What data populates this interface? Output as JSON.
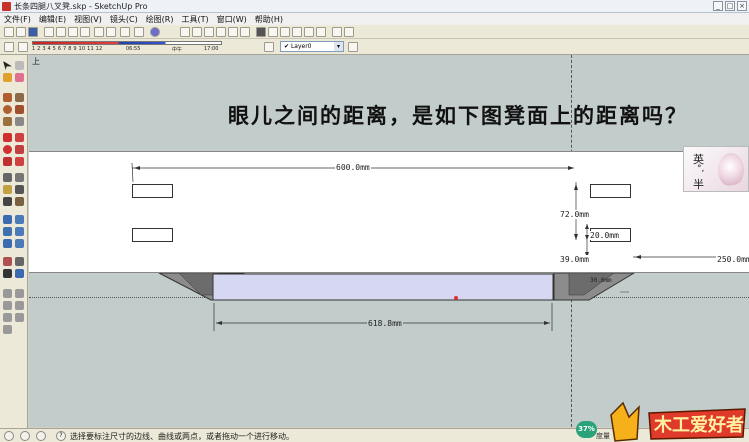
{
  "window": {
    "title": "长条四腿八叉凳.skp - SketchUp Pro",
    "min_glyph": "_",
    "max_glyph": "□",
    "close_glyph": "×"
  },
  "menu": {
    "items": [
      "文件(F)",
      "编辑(E)",
      "视图(V)",
      "镜头(C)",
      "绘图(R)",
      "工具(T)",
      "窗口(W)",
      "帮助(H)"
    ]
  },
  "shadow_settings": {
    "months_label": "1 2 3 4 5 6 7 8 9 10 11 12",
    "start_time": "06:55",
    "midday": "中午",
    "end_time": "17:00"
  },
  "layers": {
    "current_layer": "Layer0",
    "check_glyph": "✔",
    "dropdown_glyph": "▾"
  },
  "viewport": {
    "view_label": "上",
    "overlay_text": "眼儿之间的距离，是如下图凳面上的距离吗？",
    "dimensions": {
      "top_length": "600.0mm",
      "height_72": "72.0mm",
      "hole_20": "20.0mm",
      "offset_39": "39.0mm",
      "offset_250": "250.0mm",
      "bottom_length": "618.8mm",
      "small_dim": "30.0mm"
    }
  },
  "ime": {
    "lang": "英",
    "punct": "°,",
    "width_mode": "半"
  },
  "status": {
    "hint": "选择要标注尺寸的边线、曲线或两点，或者拖动一个进行移动。",
    "measure_label": "度量",
    "zoom_percent": "37%",
    "info_glyph": "?"
  },
  "watermark": {
    "brand_text": "木工爱好者"
  },
  "colors": {
    "viewport_bg": "#c2cccb",
    "band_bg": "#ffffff",
    "bench_blue": "#d6d8f2",
    "leg_gray": "#7a7a7a",
    "zoom_badge": "#2aa37a"
  }
}
